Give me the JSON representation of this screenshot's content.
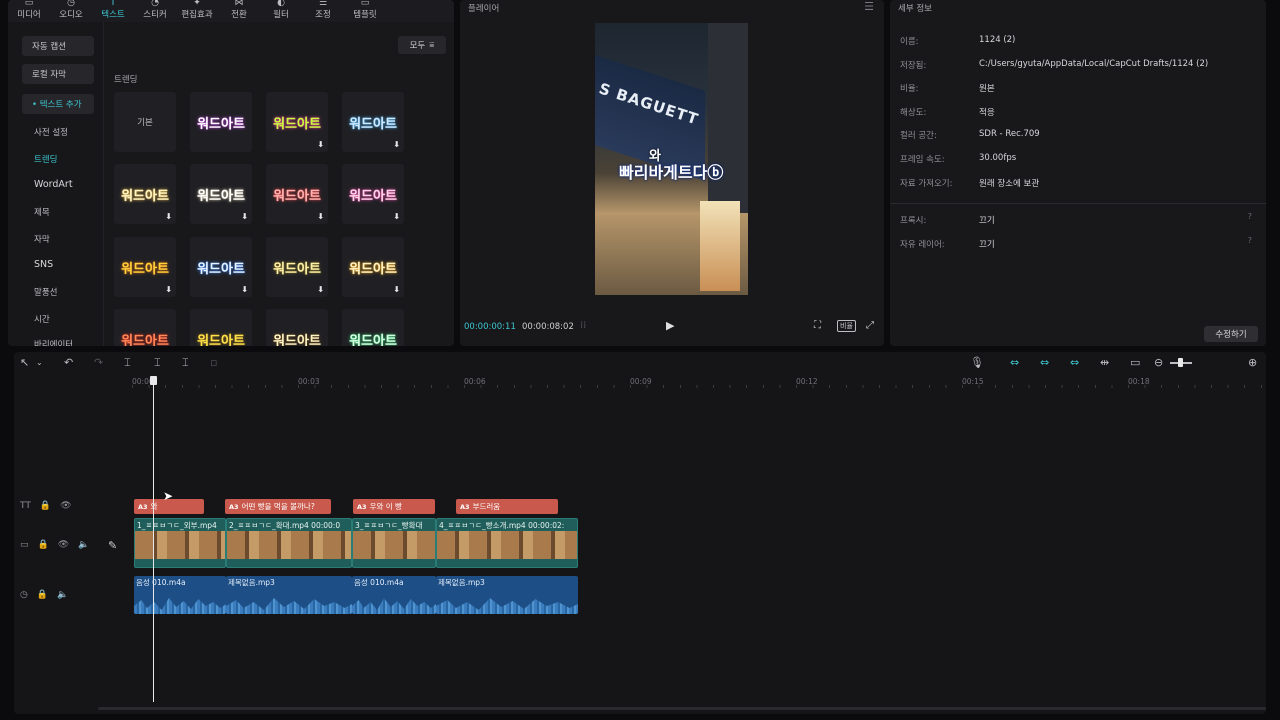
{
  "left_panel": {
    "tabs": [
      {
        "label": "미디어",
        "glyph": "▭",
        "icon": "media-icon"
      },
      {
        "label": "오디오",
        "glyph": "◷",
        "icon": "audio-icon"
      },
      {
        "label": "텍스트",
        "glyph": "T",
        "icon": "text-icon"
      },
      {
        "label": "스티커",
        "glyph": "◔",
        "icon": "sticker-icon"
      },
      {
        "label": "편집효과",
        "glyph": "✦",
        "icon": "effects-icon"
      },
      {
        "label": "전환",
        "glyph": "⋈",
        "icon": "transition-icon"
      },
      {
        "label": "필터",
        "glyph": "◐",
        "icon": "filter-icon"
      },
      {
        "label": "조정",
        "glyph": "⚌",
        "icon": "adjust-icon"
      },
      {
        "label": "템플릿",
        "glyph": "▭",
        "icon": "template-icon"
      }
    ],
    "active_tab": "텍스트",
    "nav": {
      "auto_caption": "자동 캡션",
      "local_caption": "로컬 자막",
      "add_text": "• 텍스트 추가",
      "items": [
        "사전 설정",
        "트렌딩",
        "WordArt",
        "제목",
        "자막",
        "SNS",
        "말풍선",
        "시간",
        "바리에이터"
      ]
    },
    "filter_label": "모두",
    "section_label": "트렌딩",
    "tiles": [
      {
        "label": "기본",
        "color": "#bdbdc2",
        "glow": "none",
        "download": ""
      },
      {
        "label": "워드아트",
        "color": "#ffffff",
        "glow": "#b63fd6",
        "download": ""
      },
      {
        "label": "워드아트",
        "color": "#c8ff3a",
        "glow": "#e74a9a",
        "download": "⬇"
      },
      {
        "label": "워드아트",
        "color": "#cfeaff",
        "glow": "#4aa8e7",
        "download": "⬇"
      },
      {
        "label": "워드아트",
        "color": "#fff6c8",
        "glow": "#e7b84a",
        "download": "⬇"
      },
      {
        "label": "워드아트",
        "color": "#ffffff",
        "glow": "#d6c9b0",
        "download": "⬇"
      },
      {
        "label": "워드아트",
        "color": "#ffb3b3",
        "glow": "#e74a4a",
        "download": "⬇"
      },
      {
        "label": "워드아트",
        "color": "#ffd6e8",
        "glow": "#e74aa8",
        "download": "⬇"
      },
      {
        "label": "워드아트",
        "color": "#ffd23a",
        "glow": "#c46a1c",
        "download": "⬇"
      },
      {
        "label": "워드아트",
        "color": "#e6f4ff",
        "glow": "#3a7ae7",
        "download": "⬇"
      },
      {
        "label": "워드아트",
        "color": "#fff1a8",
        "glow": "#8a7a2c",
        "download": "⬇"
      },
      {
        "label": "워드아트",
        "color": "#fff3c8",
        "glow": "#e7a21c",
        "download": "⬇"
      },
      {
        "label": "워드아트",
        "color": "#ff8a5a",
        "glow": "#c42c1c",
        "download": ""
      },
      {
        "label": "워드아트",
        "color": "#ffe14a",
        "glow": "#8a6a1c",
        "download": ""
      },
      {
        "label": "워드아트",
        "color": "#fff6c8",
        "glow": "#6a4a1c",
        "download": ""
      },
      {
        "label": "워드아트",
        "color": "#d6ffe0",
        "glow": "#3ac77a",
        "download": ""
      }
    ]
  },
  "player": {
    "title": "플레이어",
    "sign_text": "S BAGUETT",
    "caption_top": "와",
    "caption_main": "빠리바게트다ⓑ",
    "time_current": "00:00:00:11",
    "time_total": "00:00:08:02",
    "ratio_label": "비율"
  },
  "details": {
    "title": "세부 정보",
    "rows": [
      {
        "label": "이름:",
        "value": "1124 (2)"
      },
      {
        "label": "저장됨:",
        "value": "C:/Users/gyuta/AppData/Local/CapCut Drafts/1124 (2)"
      },
      {
        "label": "비율:",
        "value": "원본"
      },
      {
        "label": "해상도:",
        "value": "적응"
      },
      {
        "label": "컬러 공간:",
        "value": "SDR - Rec.709"
      },
      {
        "label": "프레임 속도:",
        "value": "30.00fps"
      },
      {
        "label": "자료 가져오기:",
        "value": "원래 장소에 보관"
      }
    ],
    "rows2": [
      {
        "label": "프록시:",
        "value": "끄기"
      },
      {
        "label": "자유 레이어:",
        "value": "끄기"
      }
    ],
    "edit_label": "수정하기"
  },
  "timeline": {
    "ticks": [
      "00:00",
      "00:03",
      "00:06",
      "00:09",
      "00:12",
      "00:15",
      "00:18"
    ],
    "text_clips": [
      {
        "label": "와"
      },
      {
        "label": "어떤 빵을 먹을 볼까나?"
      },
      {
        "label": "우와 이 빵"
      },
      {
        "label": "부드러움"
      }
    ],
    "video_clips": [
      {
        "label": "1_ㅍㅍㅂㄱㄷ_외부.mp4"
      },
      {
        "label": "2_ㅍㅍㅂㄱㄷ_확대.mp4  00:00:0"
      },
      {
        "label": "3_ㅍㅍㅂㄱㄷ_빵확대"
      },
      {
        "label": "4_ㅍㅍㅂㄱㄷ_빵소개.mp4  00:00:02:"
      }
    ],
    "audio_clips": [
      {
        "label": "음성 010.m4a"
      },
      {
        "label": "제목없음.mp3"
      },
      {
        "label": "음성 010.m4a"
      },
      {
        "label": "제목없음.mp3"
      }
    ],
    "track_text_label": "TT",
    "text_icon_label": "A3"
  }
}
